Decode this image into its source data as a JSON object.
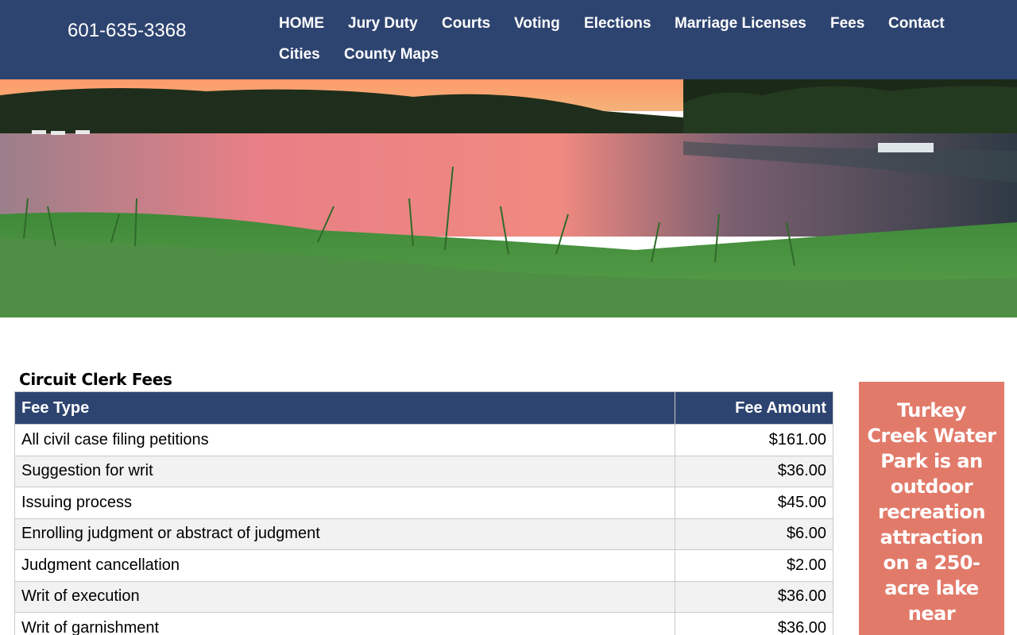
{
  "header": {
    "phone": "601-635-3368",
    "nav": [
      {
        "label": "HOME"
      },
      {
        "label": "Jury Duty"
      },
      {
        "label": "Courts"
      },
      {
        "label": "Voting"
      },
      {
        "label": "Elections"
      },
      {
        "label": "Marriage Licenses"
      },
      {
        "label": "Fees"
      },
      {
        "label": "Contact"
      },
      {
        "label": "Cities"
      },
      {
        "label": "County Maps"
      }
    ]
  },
  "colors": {
    "header_bg": "#2e4470",
    "promo_bg": "#e27a6a",
    "row_alt": "#f2f2f2"
  },
  "fees": {
    "title": "Circuit Clerk Fees",
    "columns": {
      "type": "Fee Type",
      "amount": "Fee Amount"
    },
    "rows": [
      {
        "type": "All civil case filing petitions",
        "amount": "$161.00"
      },
      {
        "type": "Suggestion for writ",
        "amount": "$36.00"
      },
      {
        "type": "Issuing process",
        "amount": "$45.00"
      },
      {
        "type": "Enrolling judgment or abstract of judgment",
        "amount": "$6.00"
      },
      {
        "type": "Judgment cancellation",
        "amount": "$2.00"
      },
      {
        "type": "Writ of execution",
        "amount": "$36.00"
      },
      {
        "type": "Writ of garnishment",
        "amount": "$36.00"
      }
    ]
  },
  "promo": {
    "text": "Turkey Creek Water Park is an outdoor recreation attraction on a 250-acre lake near"
  }
}
